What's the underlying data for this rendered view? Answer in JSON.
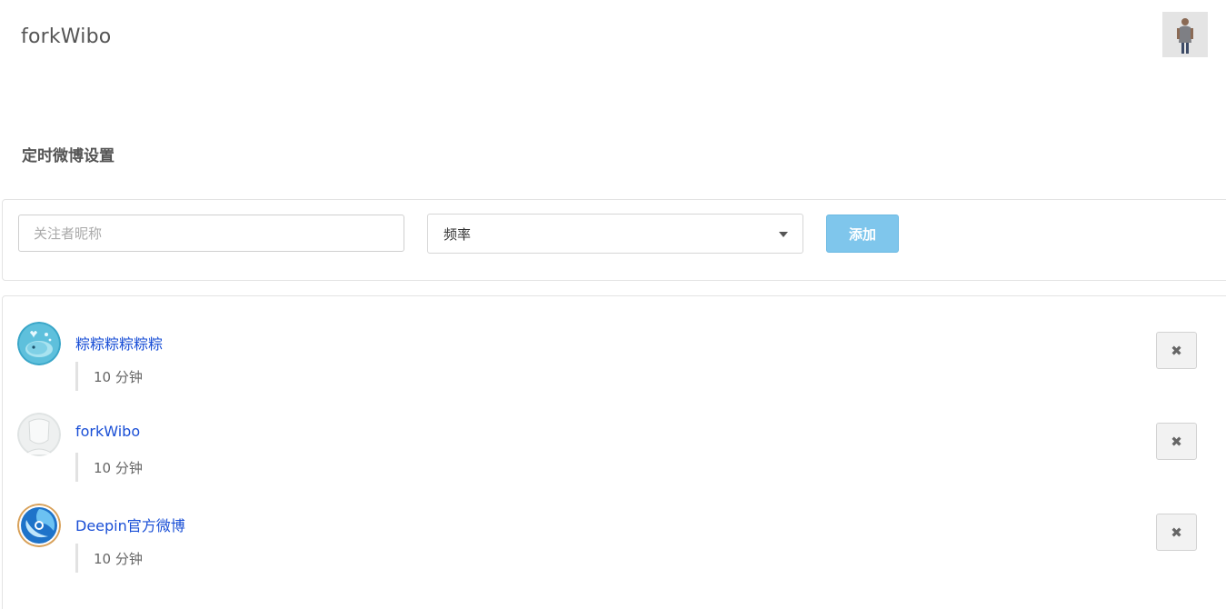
{
  "header": {
    "brand": "forkWibo",
    "user_avatar_icon": "user-avatar-photo"
  },
  "section": {
    "title": "定时微博设置"
  },
  "add_form": {
    "nickname_placeholder": "关注者昵称",
    "nickname_value": "",
    "frequency_selected": "频率",
    "add_label": "添加",
    "add_button_color": "#7fc6ec"
  },
  "items": [
    {
      "name": "粽粽粽粽粽粽",
      "frequency": "10 分钟",
      "avatar_icon": "whale-avatar",
      "delete_label": "✖"
    },
    {
      "name": "forkWibo",
      "frequency": "10 分钟",
      "avatar_icon": "default-user-avatar",
      "delete_label": "✖"
    },
    {
      "name": "Deepin官方微博",
      "frequency": "10 分钟",
      "avatar_icon": "deepin-logo-avatar",
      "delete_label": "✖"
    }
  ],
  "colors": {
    "link": "#1a4fd6",
    "border": "#e3e3e3"
  }
}
